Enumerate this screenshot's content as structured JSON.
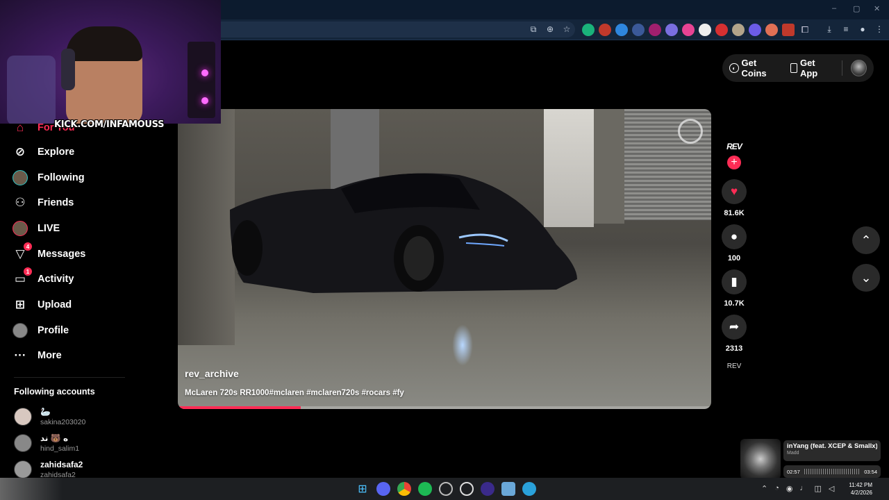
{
  "window": {
    "controls": [
      "–",
      "▢",
      "✕"
    ]
  },
  "stream": {
    "overlay_text": "KICK.COM/INFAMOUSS"
  },
  "header": {
    "get_coins_label": "Get Coins",
    "get_app_label": "Get App"
  },
  "sidebar": {
    "items": [
      {
        "label": "For You",
        "icon": "home-icon",
        "active": true
      },
      {
        "label": "Explore",
        "icon": "compass-icon"
      },
      {
        "label": "Following",
        "icon": "following-avatar"
      },
      {
        "label": "Friends",
        "icon": "friends-icon"
      },
      {
        "label": "LIVE",
        "icon": "live-avatar"
      },
      {
        "label": "Messages",
        "icon": "send-icon",
        "badge": "4"
      },
      {
        "label": "Activity",
        "icon": "inbox-icon",
        "badge": "1"
      },
      {
        "label": "Upload",
        "icon": "plus-square-icon"
      },
      {
        "label": "Profile",
        "icon": "profile-avatar"
      },
      {
        "label": "More",
        "icon": "more-icon"
      }
    ],
    "following_title": "Following accounts",
    "following_accounts": [
      {
        "name": "🦢",
        "handle": "sakina203020"
      },
      {
        "name": "ه 🐻 ند",
        "handle": "hind_salim1"
      },
      {
        "name": "zahidsafa2",
        "handle": "zahidsafa2"
      }
    ]
  },
  "video": {
    "username": "rev_archive",
    "caption": "McLaren 720s RR1000#mclaren #mclaren720s #rocars #fy",
    "progress": 0.23,
    "accent_color": "#fe2c55"
  },
  "actions": {
    "creator_logo_text": "REV",
    "follow_symbol": "+",
    "like_count": "81.6K",
    "comment_count": "100",
    "bookmark_count": "10.7K",
    "share_count": "2313",
    "sound_label": "REV"
  },
  "music_widget": {
    "title": "inYang (feat. XCEP & Smallx)",
    "artist": "Madd",
    "elapsed": "02:57",
    "duration": "03:54"
  },
  "taskbar": {
    "time": "11:42 PM",
    "date": "4/2/2026"
  }
}
